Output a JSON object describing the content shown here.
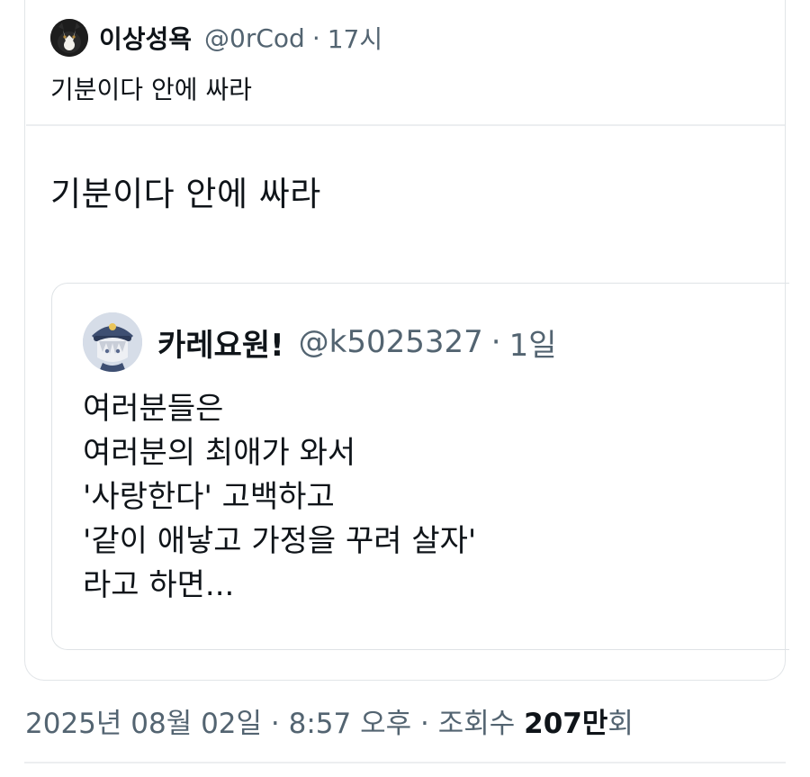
{
  "tweet": {
    "author": {
      "display_name": "이상성욕",
      "handle": "@0rCod",
      "avatar_icon": "cat-avatar-icon"
    },
    "separator": "·",
    "time": "17시",
    "text_preview": "기분이다 안에 싸라",
    "text_large": "기분이다 안에 싸라"
  },
  "quoted_tweet": {
    "author": {
      "display_name": "카레요원!",
      "handle": "@k5025327",
      "avatar_icon": "anime-officer-avatar-icon"
    },
    "separator": "·",
    "time": "1일",
    "lines": [
      "여러분들은",
      "여러분의 최애가 와서",
      "'사랑한다' 고백하고",
      "'같이 애낳고 가정을 꾸려 살자'",
      "라고 하면..."
    ]
  },
  "meta": {
    "date": "2025년 08월 02일",
    "separator1": "·",
    "time": "8:57 오후",
    "separator2": "·",
    "views_label": "조회수",
    "views_count": "207만",
    "views_suffix": "회"
  },
  "colors": {
    "text_primary": "#0f1419",
    "text_secondary": "#536471",
    "border": "#e2e5e8"
  }
}
